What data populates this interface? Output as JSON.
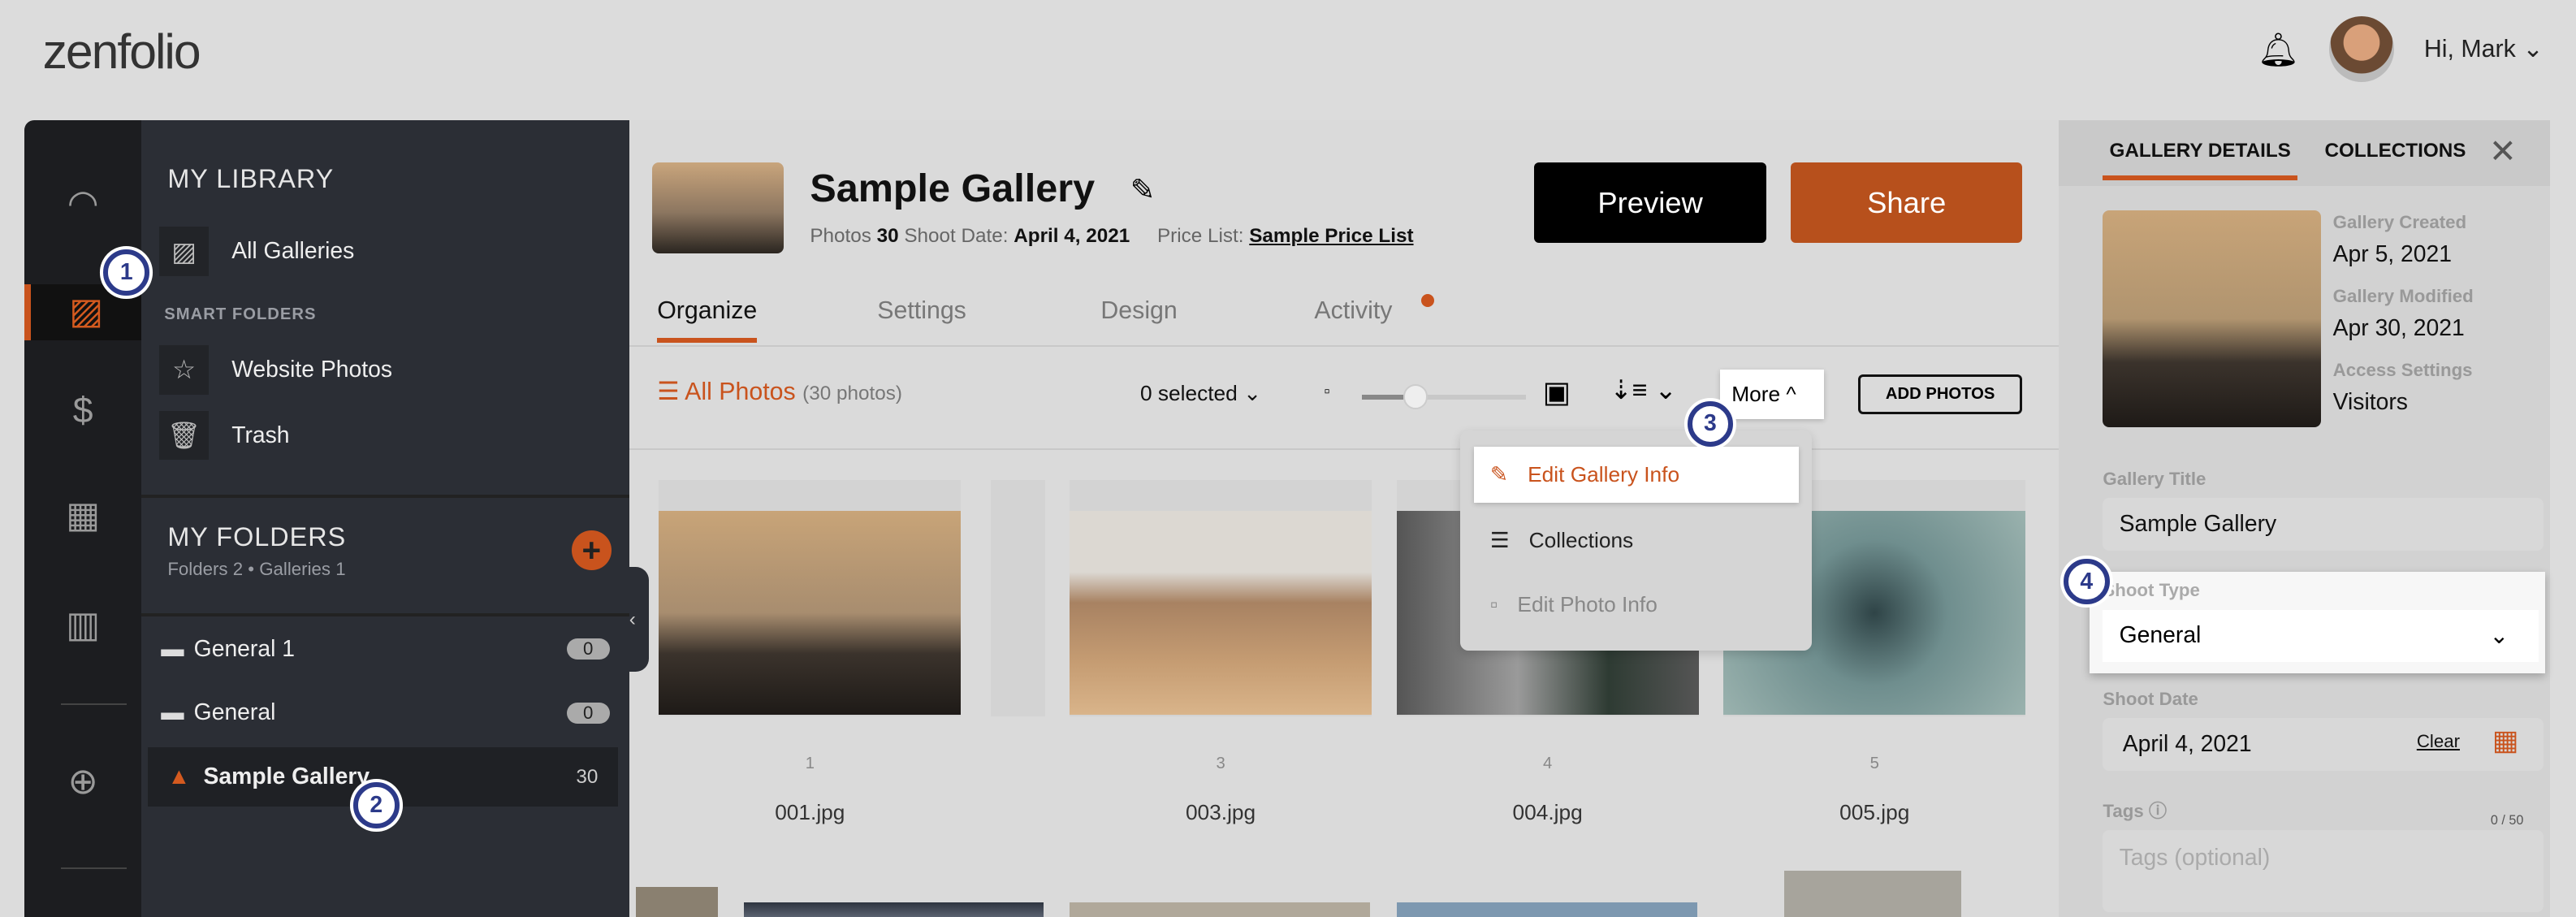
{
  "topbar": {
    "logo": "zenfolio",
    "greeting": "Hi, Mark"
  },
  "library": {
    "title": "MY LIBRARY",
    "all_galleries": "All Galleries",
    "smart_folders": "SMART FOLDERS",
    "website_photos": "Website Photos",
    "trash": "Trash",
    "folders_title": "MY FOLDERS",
    "folders_summary": "Folders 2 • Galleries 1",
    "folders": [
      {
        "name": "General 1",
        "count": "0"
      },
      {
        "name": "General",
        "count": "0"
      }
    ],
    "gallery": {
      "name": "Sample Gallery",
      "count": "30"
    }
  },
  "gallery": {
    "title": "Sample Gallery",
    "photos_label": "Photos",
    "photos_count": "30",
    "shoot_date_label": "Shoot Date:",
    "shoot_date": "April 4, 2021",
    "price_list_label": "Price List:",
    "price_list": "Sample Price List",
    "preview": "Preview",
    "share": "Share"
  },
  "tabs": [
    "Organize",
    "Settings",
    "Design",
    "Activity"
  ],
  "toolbar": {
    "all_photos": "All Photos",
    "photo_count": "(30 photos)",
    "selected": "0 selected",
    "more": "More",
    "add_photos": "ADD PHOTOS"
  },
  "more_menu": [
    "Edit Gallery Info",
    "Collections",
    "Edit Photo Info"
  ],
  "photos": [
    {
      "num": "1",
      "file": "001.jpg"
    },
    {
      "num": "3",
      "file": "003.jpg"
    },
    {
      "num": "4",
      "file": "004.jpg"
    },
    {
      "num": "5",
      "file": "005.jpg"
    }
  ],
  "steps": [
    "1",
    "2",
    "3",
    "4"
  ],
  "panel": {
    "tab_details": "GALLERY DETAILS",
    "tab_collections": "COLLECTIONS",
    "created_label": "Gallery Created",
    "created": "Apr 5, 2021",
    "modified_label": "Gallery Modified",
    "modified": "Apr 30, 2021",
    "access_label": "Access Settings",
    "access": "Visitors",
    "title_label": "Gallery Title",
    "title_value": "Sample Gallery",
    "shoot_type_label": "Shoot Type",
    "shoot_type": "General",
    "shoot_date_label": "Shoot Date",
    "shoot_date": "April 4, 2021",
    "clear": "Clear",
    "tags_label": "Tags",
    "tags_count": "0 / 50",
    "tags_placeholder": "Tags (optional)"
  },
  "colors": {
    "accent": "#c9531d",
    "step": "#2c3a8a"
  }
}
